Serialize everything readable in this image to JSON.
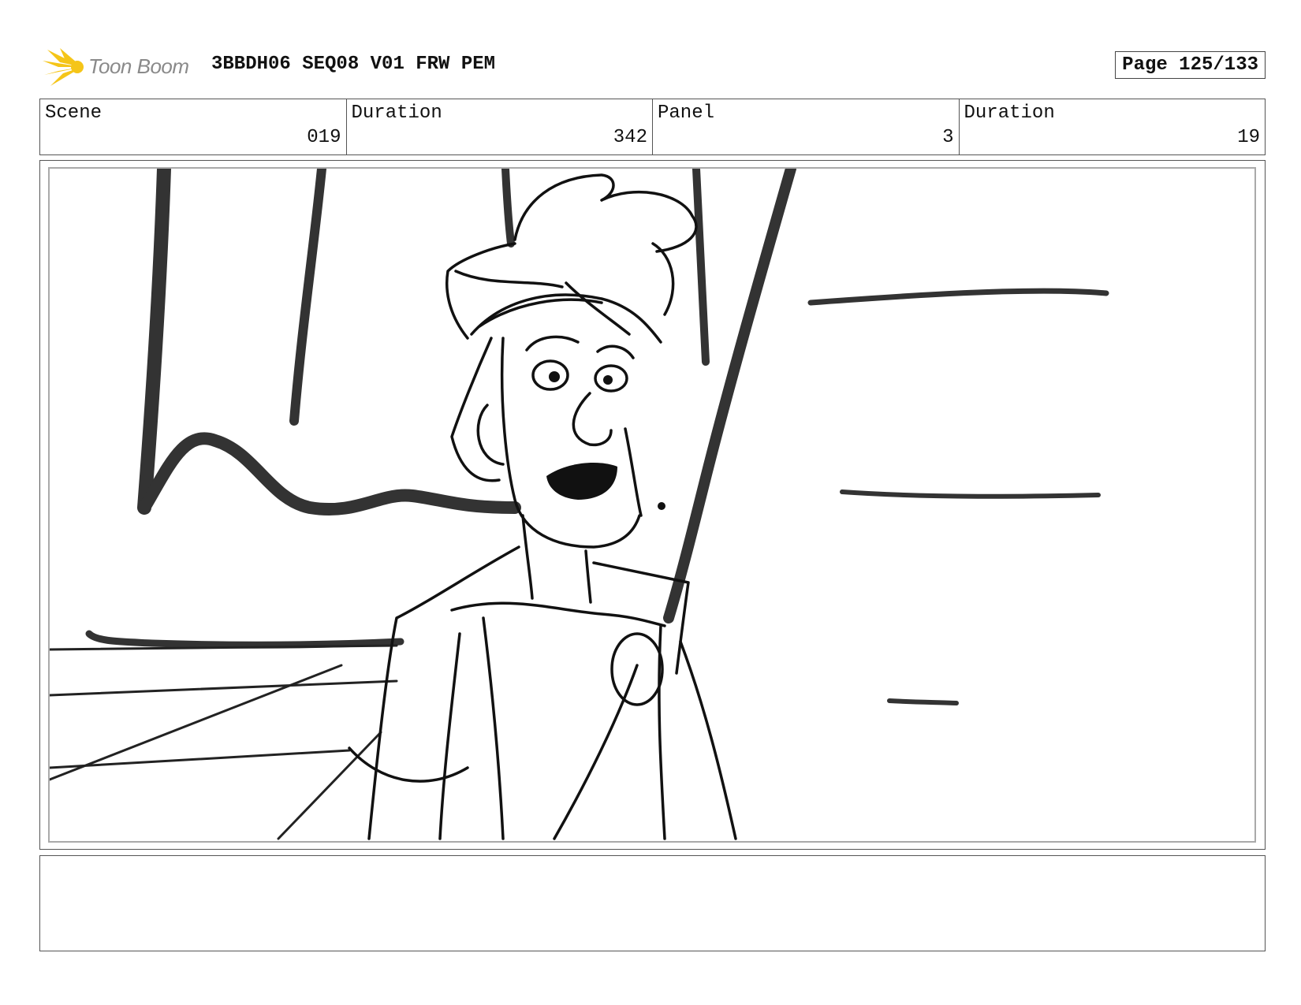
{
  "header": {
    "logo_text": "Toon Boom",
    "title": "3BBDH06 SEQ08 V01 FRW PEM",
    "page_label": "Page 125/133",
    "logo_color": "#F5C518"
  },
  "info": {
    "scene_label": "Scene",
    "scene_value": "019",
    "duration_label": "Duration",
    "duration_value": "342",
    "panel_label": "Panel",
    "panel_value": "3",
    "panel_duration_label": "Duration",
    "panel_duration_value": "19"
  },
  "notes": {
    "text": ""
  }
}
